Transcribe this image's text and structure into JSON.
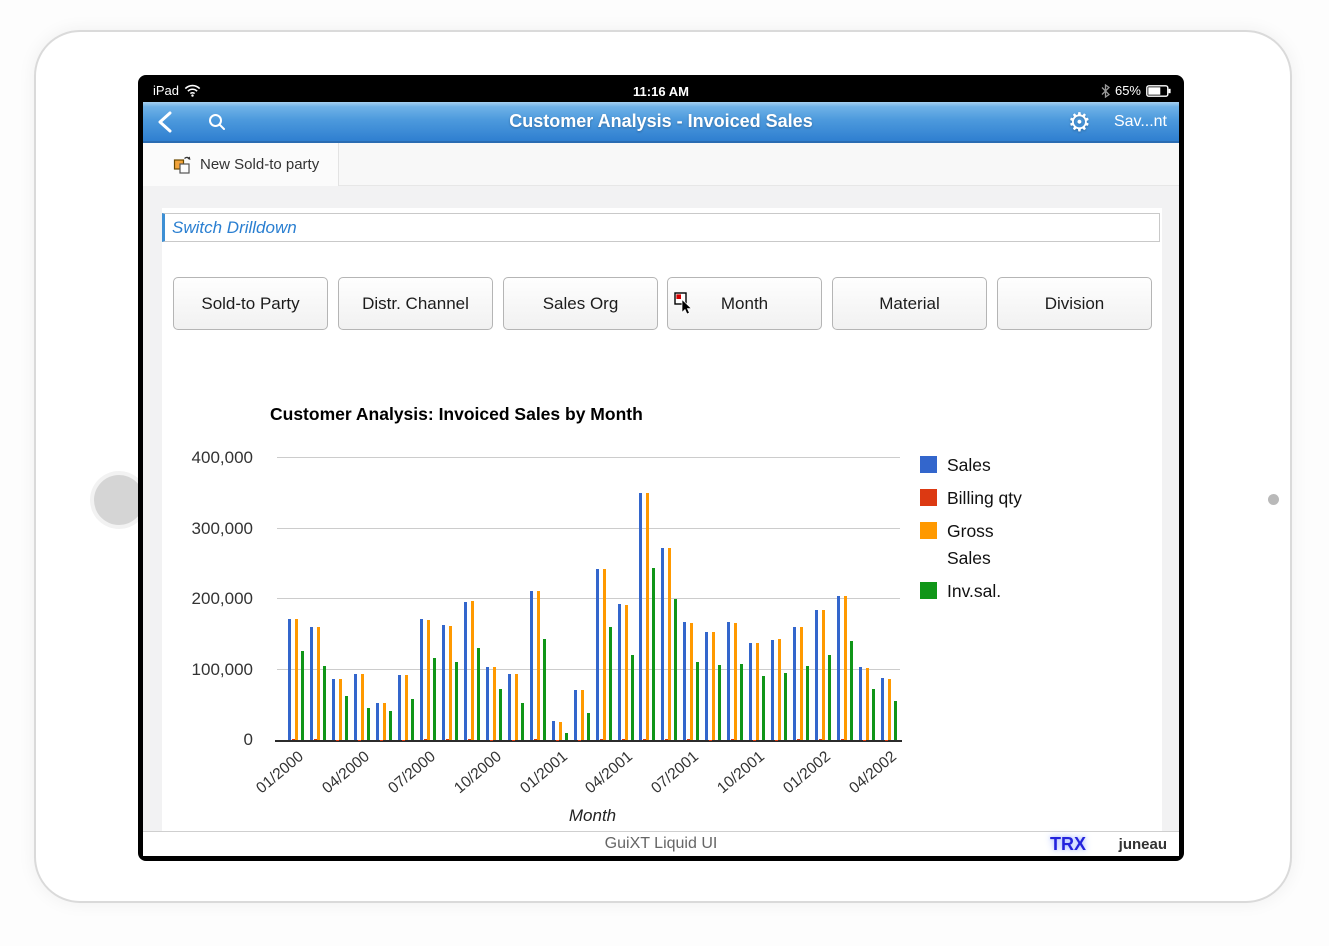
{
  "statusbar": {
    "left_label": "iPad",
    "time": "11:16 AM",
    "battery_percent": "65%"
  },
  "navbar": {
    "title": "Customer Analysis - Invoiced Sales",
    "save_label": "Sav...nt"
  },
  "toolbar": {
    "new_soldto_label": "New Sold-to party"
  },
  "drilldown": {
    "label": "Switch Drilldown",
    "buttons": [
      "Sold-to Party",
      "Distr. Channel",
      "Sales Org",
      "Month",
      "Material",
      "Division"
    ],
    "cursor_on": "Month"
  },
  "footer": {
    "brand": "GuiXT Liquid UI",
    "trx": "TRX",
    "user": "juneau"
  },
  "colors": {
    "accent_blue": "#2a7fd1",
    "nav_top": "#6fb2e7",
    "nav_bottom": "#2f7fd0"
  },
  "chart_data": {
    "type": "bar",
    "title": "Customer Analysis: Invoiced Sales by Month",
    "xlabel": "Month",
    "ylabel": "",
    "ylim": [
      0,
      400000
    ],
    "ytick_labels": [
      "0",
      "100,000",
      "200,000",
      "300,000",
      "400,000"
    ],
    "grid": true,
    "legend_position": "right",
    "categories": [
      "01/2000",
      "02/2000",
      "03/2000",
      "04/2000",
      "05/2000",
      "06/2000",
      "07/2000",
      "08/2000",
      "09/2000",
      "10/2000",
      "11/2000",
      "12/2000",
      "01/2001",
      "02/2001",
      "03/2001",
      "04/2001",
      "05/2001",
      "06/2001",
      "07/2001",
      "08/2001",
      "09/2001",
      "10/2001",
      "11/2001",
      "12/2001",
      "01/2002",
      "02/2002",
      "03/2002",
      "04/2002"
    ],
    "xtick_shown": [
      "01/2000",
      "04/2000",
      "07/2000",
      "10/2000",
      "01/2001",
      "04/2001",
      "07/2001",
      "10/2001",
      "01/2002",
      "04/2002"
    ],
    "series": [
      {
        "name": "Sales",
        "color": "#3366cc",
        "values": [
          172000,
          161000,
          87000,
          93000,
          53000,
          92000,
          171000,
          163000,
          196000,
          103000,
          94000,
          212000,
          27000,
          71000,
          243000,
          193000,
          350000,
          273000,
          167000,
          153000,
          167000,
          138000,
          142000,
          160000,
          184000,
          204000,
          104000,
          88000
        ]
      },
      {
        "name": "Billing qty",
        "color": "#dc3912",
        "values": [
          860,
          800,
          440,
          470,
          270,
          460,
          860,
          820,
          980,
          520,
          470,
          1060,
          140,
          360,
          1220,
          970,
          1750,
          1370,
          840,
          770,
          840,
          690,
          710,
          800,
          920,
          1020,
          520,
          440
        ]
      },
      {
        "name": "Gross Sales",
        "color": "#ff9900",
        "values": [
          172000,
          161000,
          87000,
          93000,
          53000,
          92000,
          170000,
          162000,
          197000,
          104000,
          93000,
          212000,
          26000,
          71000,
          243000,
          192000,
          350000,
          273000,
          166000,
          153000,
          166000,
          138000,
          143000,
          160000,
          184000,
          204000,
          102000,
          87000
        ]
      },
      {
        "name": "Inv.sal.",
        "color": "#109618",
        "values": [
          127000,
          105000,
          62000,
          46000,
          41000,
          58000,
          117000,
          110000,
          130000,
          73000,
          53000,
          143000,
          10000,
          38000,
          161000,
          120000,
          244000,
          200000,
          110000,
          107000,
          108000,
          91000,
          95000,
          105000,
          120000,
          140000,
          72000,
          55000
        ]
      }
    ]
  }
}
